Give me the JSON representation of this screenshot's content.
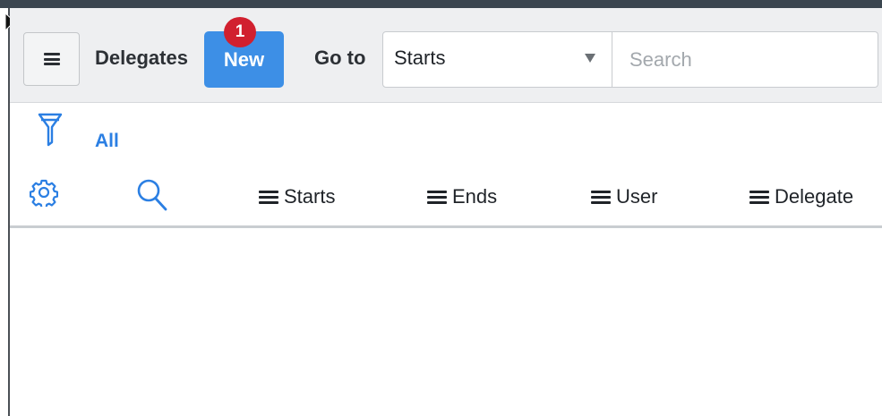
{
  "toolbar": {
    "title": "Delegates",
    "new_label": "New",
    "badge_count": "1",
    "goto_label": "Go to",
    "goto_select": {
      "selected": "Starts"
    },
    "search": {
      "placeholder": "Search",
      "value": ""
    }
  },
  "filter": {
    "breadcrumb_all": "All"
  },
  "columns": [
    {
      "label": "Starts"
    },
    {
      "label": "Ends"
    },
    {
      "label": "User"
    },
    {
      "label": "Delegate"
    }
  ],
  "icons": {
    "menu": "hamburger-menu-icon",
    "filter": "funnel-filter-icon",
    "settings": "gear-icon",
    "search": "magnifier-search-icon",
    "column_menu": "column-context-menu-icon",
    "dropdown": "triangle-down-icon"
  },
  "colors": {
    "accent": "#3d8fe6",
    "link": "#2b7fe3",
    "badge": "#d1202f",
    "toolbar_bg": "#eeeff1"
  }
}
